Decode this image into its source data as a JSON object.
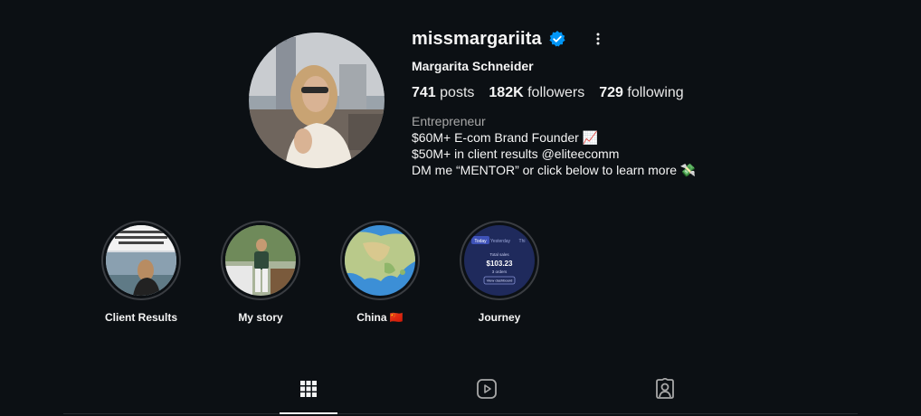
{
  "profile": {
    "username": "missmargariita",
    "full_name": "Margarita Schneider",
    "verified_icon": "verified-badge-icon",
    "more_icon": "more-options-icon"
  },
  "stats": {
    "posts_count": "741",
    "posts_label": "posts",
    "followers_count": "182K",
    "followers_label": "followers",
    "following_count": "729",
    "following_label": "following"
  },
  "bio": {
    "category": "Entrepreneur",
    "line1": "$60M+ E-com Brand Founder 📈",
    "line2": "$50M+ in client results @eliteecomm",
    "line3": "DM me “MENTOR” or click below to learn more 💸"
  },
  "highlights": [
    {
      "label": "Client Results"
    },
    {
      "label": "My story"
    },
    {
      "label": "China 🇨🇳"
    },
    {
      "label": "Journey"
    }
  ],
  "journey_thumb": {
    "tab_today": "Today",
    "tab_yesterday": "Yesterday",
    "tab_more": "Thi",
    "total_label": "Total sales",
    "amount": "$103.23",
    "orders": "3 orders",
    "button": "View dashboard"
  },
  "tabs": [
    {
      "icon": "grid-icon",
      "active": true
    },
    {
      "icon": "reels-icon",
      "active": false
    },
    {
      "icon": "tagged-icon",
      "active": false
    }
  ],
  "colors": {
    "background": "#0c1014",
    "verified": "#0095f6",
    "text": "#f5f5f5",
    "secondary_text": "#a8a8a8"
  }
}
